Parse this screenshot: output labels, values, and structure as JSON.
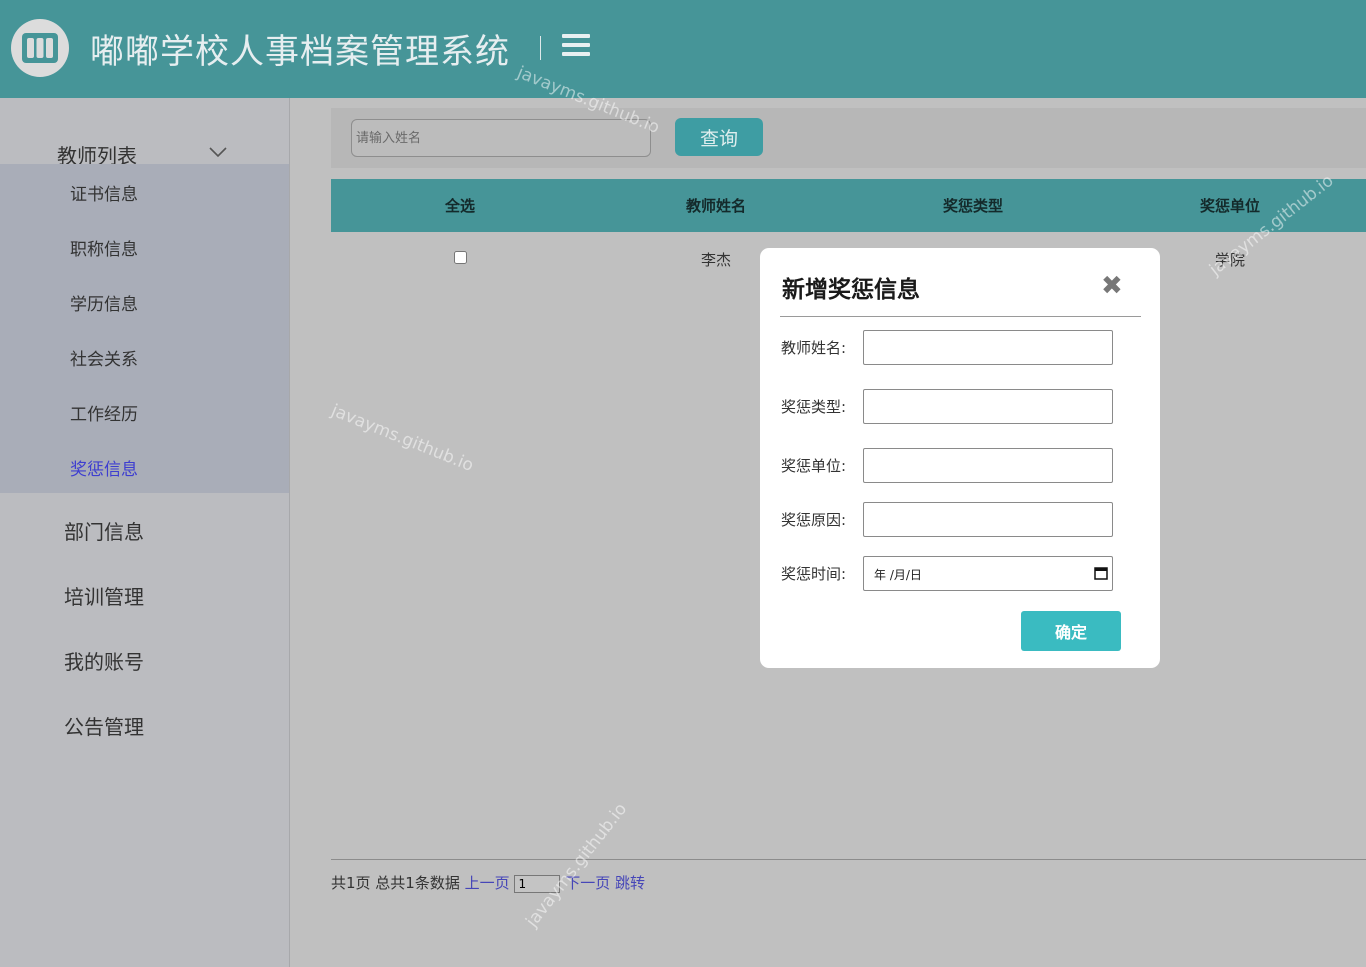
{
  "header": {
    "title": "嘟嘟学校人事档案管理系统",
    "logo_icon": "books-icon",
    "menu_icon": "hamburger-icon"
  },
  "sidebar": {
    "group_title": "教师列表",
    "group_icon": "chevron-down-icon",
    "sub_items": [
      "证书信息",
      "职称信息",
      "学历信息",
      "社会关系",
      "工作经历",
      "奖惩信息"
    ],
    "active_sub_item": "奖惩信息",
    "nav_items": [
      "部门信息",
      "培训管理",
      "我的账号",
      "公告管理"
    ]
  },
  "search": {
    "placeholder": "请输入姓名",
    "value": "",
    "button_label": "查询"
  },
  "table": {
    "columns": [
      "全选",
      "教师姓名",
      "奖惩类型",
      "奖惩单位"
    ],
    "rows": [
      {
        "checked": false,
        "name": "李杰",
        "type": "",
        "unit": "学院"
      }
    ]
  },
  "pagination": {
    "summary": "共1页 总共1条数据",
    "prev_label": "上一页",
    "page_value": "1",
    "next_label": "下一页",
    "jump_label": "跳转"
  },
  "modal": {
    "title": "新增奖惩信息",
    "close_icon": "close-icon",
    "fields": [
      {
        "label": "教师姓名:",
        "value": ""
      },
      {
        "label": "奖惩类型:",
        "value": ""
      },
      {
        "label": "奖惩单位:",
        "value": ""
      },
      {
        "label": "奖惩原因:",
        "value": ""
      },
      {
        "label": "奖惩时间:",
        "value": ""
      }
    ],
    "date_placeholder": "年 /月/日",
    "confirm_label": "确定"
  },
  "watermark": "javayms.github.io",
  "colors": {
    "header": "#469598",
    "table_header": "#469598",
    "confirm_button": "#3abbc1",
    "active_link": "#3e3ed0"
  }
}
